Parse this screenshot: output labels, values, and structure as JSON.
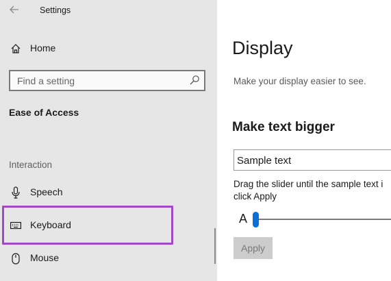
{
  "window": {
    "title": "Settings"
  },
  "nav": {
    "home_label": "Home",
    "search": {
      "placeholder": "Find a setting",
      "value": ""
    },
    "section_heading": "Ease of Access",
    "group_label": "Interaction",
    "items": [
      {
        "label": "Speech",
        "icon": "microphone-icon"
      },
      {
        "label": "Keyboard",
        "icon": "keyboard-icon",
        "selected": true
      },
      {
        "label": "Mouse",
        "icon": "mouse-icon"
      }
    ],
    "highlight_color": "#a048c8"
  },
  "main": {
    "page_title": "Display",
    "page_subtitle": "Make your display easier to see.",
    "section_title": "Make text bigger",
    "sample_text": "Sample text",
    "instruction_line1": "Drag the slider until the sample text i",
    "instruction_line2": "click Apply",
    "slider_label": "A",
    "slider_value_percent": 0,
    "apply_label": "Apply",
    "accent_color": "#0a70d8"
  }
}
